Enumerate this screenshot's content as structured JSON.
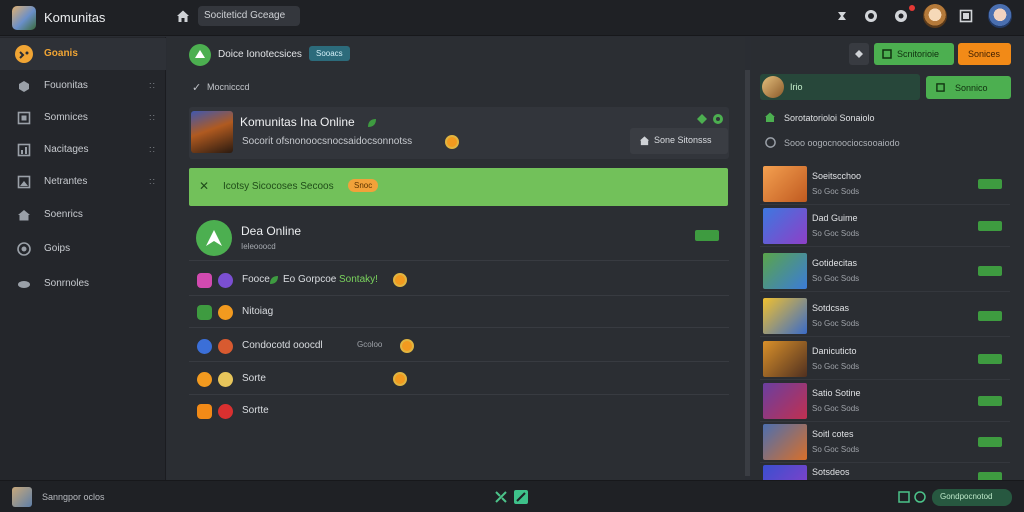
{
  "header": {
    "title": "Komunitas",
    "search_label": "Sociteticd Gceage",
    "icons": [
      "home-icon",
      "gamepad-icon",
      "globe-icon",
      "notification-icon",
      "avatar",
      "window-icon",
      "avatar"
    ]
  },
  "sidebar": {
    "items": [
      {
        "label": "Goanis",
        "icon": "smile-icon",
        "active": true,
        "dots": ""
      },
      {
        "label": "Fouonitas",
        "icon": "puzzle-icon",
        "active": false,
        "dots": "::"
      },
      {
        "label": "Somnices",
        "icon": "window-icon",
        "active": false,
        "dots": "::"
      },
      {
        "label": "Nacitages",
        "icon": "chart-icon",
        "active": false,
        "dots": "::"
      },
      {
        "label": "Netrantes",
        "icon": "image-icon",
        "active": false,
        "dots": "::"
      },
      {
        "label": "Soenrics",
        "icon": "home-icon",
        "active": false,
        "dots": ""
      },
      {
        "label": "Goips",
        "icon": "shield-icon",
        "active": false,
        "dots": ""
      },
      {
        "label": "Sonrnoles",
        "icon": "gamepad-icon",
        "active": false,
        "dots": ""
      }
    ]
  },
  "main": {
    "header_title": "Doice Ionotecsices",
    "header_tag": "Sooacs",
    "section_label": "Mocnicccd",
    "card": {
      "title": "Komunitas Ina Online",
      "subtitle": "Socorit ofsnonoocsnocsaidocsonnotss",
      "button_label": "Sone Sitonsss"
    },
    "banner": {
      "label": "Icotsy Sicocoses Secoos",
      "tag": "Snoc"
    },
    "status": {
      "title": "Dea Online",
      "subtitle": "Ieleooocd"
    },
    "feed": [
      {
        "label": "Fooce",
        "extra": "Eo Gorpcoe",
        "extra2": "Sontaky!",
        "colors": [
          "#d24ab0",
          "#7b4fd2"
        ]
      },
      {
        "label": "Nitoiag",
        "extra": "",
        "extra2": "",
        "colors": [
          "#3e9b40",
          "#f29a1f"
        ]
      },
      {
        "label": "Condocotd ooocdl",
        "extra": "Gcoloo",
        "extra2": "",
        "colors": [
          "#3b6fd8",
          "#d85a30"
        ]
      },
      {
        "label": "Sorte",
        "extra": "",
        "extra2": "",
        "colors": [
          "#f29a1f",
          "#e7c55b"
        ]
      },
      {
        "label": "Sortte",
        "extra": "",
        "extra2": "",
        "colors": [
          "#f28a17",
          "#d93030"
        ]
      }
    ]
  },
  "right_panel": {
    "toolbar": {
      "btn1_label": "Scnitorioie",
      "btn2_label": "Sonices"
    },
    "user_name": "Irio",
    "join_label": "Sonnico",
    "line1": "Sorotatorioloi Sonaiolo",
    "line2": "Sooo oogocnoociocsooaiodo",
    "games": [
      {
        "title": "Soeitscchoo",
        "sub": "So Goc Sods",
        "colors": [
          "#f4a050",
          "#c05a20"
        ]
      },
      {
        "title": "Dad Guime",
        "sub": "So Goc Sods",
        "colors": [
          "#3d78e0",
          "#8e3fc7"
        ]
      },
      {
        "title": "Gotidecitas",
        "sub": "So Goc Sods",
        "colors": [
          "#5aa54a",
          "#3b7bd8"
        ]
      },
      {
        "title": "Sotdcsas",
        "sub": "So Goc Sods",
        "colors": [
          "#f0c030",
          "#3a6bc8"
        ]
      },
      {
        "title": "Danicuticto",
        "sub": "So Goc Sods",
        "colors": [
          "#d9902a",
          "#503020"
        ]
      },
      {
        "title": "Satio Sotine",
        "sub": "So Goc Sods",
        "colors": [
          "#6a3fa0",
          "#c03050"
        ]
      },
      {
        "title": "Soitl cotes",
        "sub": "So Goc Sods",
        "colors": [
          "#4c6fb0",
          "#d86f2a"
        ]
      },
      {
        "title": "Sotsdeos",
        "sub": "",
        "colors": [
          "#3a4fd0",
          "#8e3fc7"
        ]
      }
    ]
  },
  "footer": {
    "label": "Sanngpor oclos",
    "pill_label": "Gondpocnotod"
  }
}
